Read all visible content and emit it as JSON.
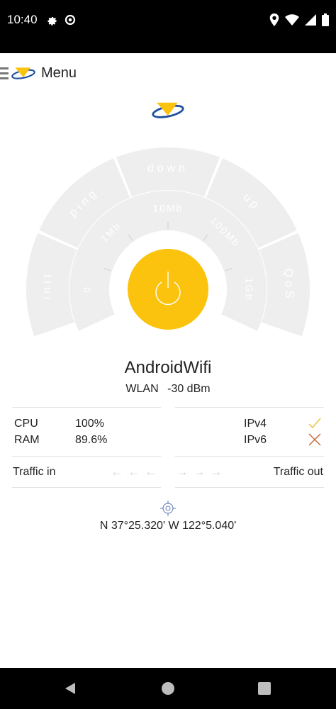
{
  "status_bar": {
    "time": "10:40",
    "left_icons": [
      "gear-icon",
      "data-saver-icon"
    ],
    "right_icons": [
      "location-icon",
      "wifi-icon",
      "signal-icon",
      "battery-icon"
    ]
  },
  "app_bar": {
    "menu_label": "Menu"
  },
  "gauge": {
    "outer_segments": [
      "init",
      "ping",
      "down",
      "up",
      "QoS"
    ],
    "inner_labels": [
      "0",
      "1Mb",
      "10Mb",
      "100Mb",
      "1Gb"
    ],
    "button_color": "#fbc30d"
  },
  "network": {
    "name": "AndroidWifi",
    "type": "WLAN",
    "signal": "-30 dBm"
  },
  "stats": {
    "cpu_label": "CPU",
    "cpu_value": "100%",
    "ram_label": "RAM",
    "ram_value": "89.6%",
    "ipv4_label": "IPv4",
    "ipv4_status": "check",
    "ipv6_label": "IPv6",
    "ipv6_status": "cross",
    "traffic_in_label": "Traffic in",
    "traffic_out_label": "Traffic out"
  },
  "location": {
    "coords": "N 37°25.320' W 122°5.040'"
  },
  "colors": {
    "accent": "#fbc30d",
    "check": "#f0c040",
    "cross": "#c86a3a",
    "gauge_bg": "#eeeeef"
  }
}
